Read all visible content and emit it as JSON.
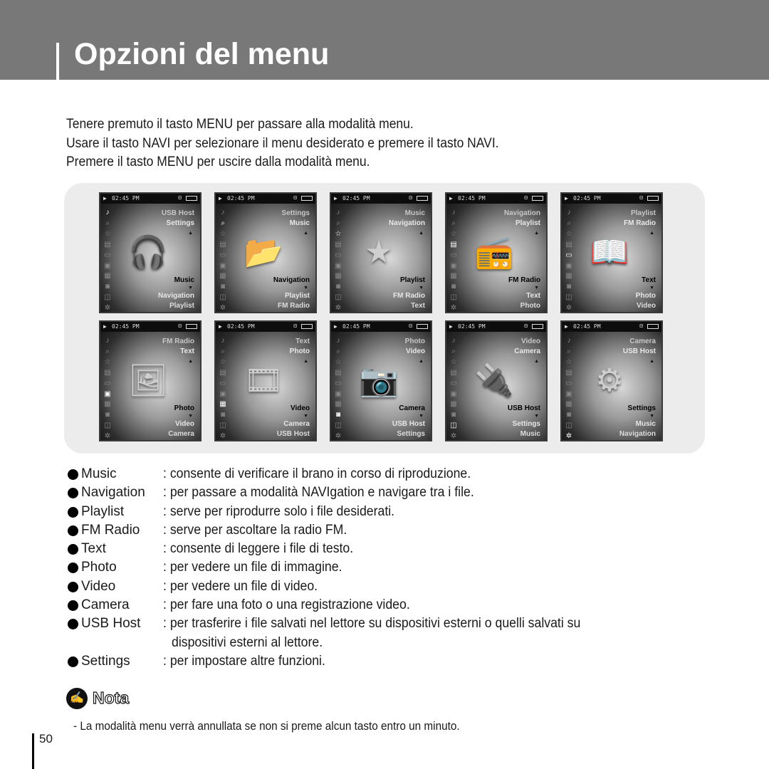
{
  "header": {
    "title": "Opzioni del menu",
    "color": "#787878"
  },
  "intro": [
    "Tenere premuto il tasto MENU per passare alla modalità menu.",
    "Usare il tasto NAVI per selezionare il menu desiderato e premere il tasto NAVI.",
    "Premere il tasto MENU per uscire dalla modalità menu."
  ],
  "screens": [
    {
      "time": "02:45 PM",
      "prev1": "USB Host",
      "prev2": "Settings",
      "current": "Music",
      "next1": "Navigation",
      "next2": "Playlist",
      "art": "headphones-icon",
      "glyph": "🎧",
      "active": 0
    },
    {
      "time": "02:45 PM",
      "prev1": "Settings",
      "prev2": "Music",
      "current": "Navigation",
      "next1": "Playlist",
      "next2": "FM Radio",
      "art": "folder-magnifier-icon",
      "glyph": "📂",
      "active": 1
    },
    {
      "time": "02:45 PM",
      "prev1": "Music",
      "prev2": "Navigation",
      "current": "Playlist",
      "next1": "FM Radio",
      "next2": "Text",
      "art": "star-icon",
      "glyph": "★",
      "active": 2
    },
    {
      "time": "02:45 PM",
      "prev1": "Navigation",
      "prev2": "Playlist",
      "current": "FM Radio",
      "next1": "Text",
      "next2": "Photo",
      "art": "radio-icon",
      "glyph": "📻",
      "active": 3
    },
    {
      "time": "02:45 PM",
      "prev1": "Playlist",
      "prev2": "FM Radio",
      "current": "Text",
      "next1": "Photo",
      "next2": "Video",
      "art": "book-icon",
      "glyph": "📖",
      "active": 4
    },
    {
      "time": "02:45 PM",
      "prev1": "FM Radio",
      "prev2": "Text",
      "current": "Photo",
      "next1": "Video",
      "next2": "Camera",
      "art": "photo-album-icon",
      "glyph": "🖼",
      "active": 5
    },
    {
      "time": "02:45 PM",
      "prev1": "Text",
      "prev2": "Photo",
      "current": "Video",
      "next1": "Camera",
      "next2": "USB Host",
      "art": "film-reel-icon",
      "glyph": "🎞",
      "active": 6
    },
    {
      "time": "02:45 PM",
      "prev1": "Photo",
      "prev2": "Video",
      "current": "Camera",
      "next1": "USB Host",
      "next2": "Settings",
      "art": "camera-icon",
      "glyph": "📷",
      "active": 7
    },
    {
      "time": "02:45 PM",
      "prev1": "Video",
      "prev2": "Camera",
      "current": "USB Host",
      "next1": "Settings",
      "next2": "Music",
      "art": "usb-stick-icon",
      "glyph": "🔌",
      "active": 8
    },
    {
      "time": "02:45 PM",
      "prev1": "Camera",
      "prev2": "USB Host",
      "current": "Settings",
      "next1": "Music",
      "next2": "Navigation",
      "art": "gear-icon",
      "glyph": "⚙",
      "active": 9
    }
  ],
  "side_icons": [
    "♪",
    "⌕",
    "☆",
    "▤",
    "▭",
    "▣",
    "▦",
    "◙",
    "◫",
    "✲"
  ],
  "menu_items": [
    {
      "term": "Music",
      "desc": ": consente di verificare il brano in corso di riproduzione."
    },
    {
      "term": "Navigation",
      "desc": ": per passare a modalità NAVIgation e navigare tra i file."
    },
    {
      "term": "Playlist",
      "desc": ": serve per riprodurre solo i file desiderati."
    },
    {
      "term": "FM Radio",
      "desc": ": serve per ascoltare la radio FM."
    },
    {
      "term": "Text",
      "desc": ": consente di leggere i file di testo."
    },
    {
      "term": "Photo",
      "desc": ": per vedere un file di immagine."
    },
    {
      "term": "Video",
      "desc": ": per vedere un file di video."
    },
    {
      "term": "Camera",
      "desc": ": per fare una foto o una registrazione video."
    },
    {
      "term": "USB Host",
      "desc": ": per trasferire i file salvati nel lettore su dispositivi esterni o quelli salvati su",
      "desc2": "dispositivi esterni al lettore."
    },
    {
      "term": "Settings",
      "desc": ": per impostare altre funzioni."
    }
  ],
  "note": {
    "icon": "pencil-note-icon",
    "title": "Nota",
    "text": "- La modalità menu verrà annullata se non si preme alcun tasto entro un minuto."
  },
  "page_number": "50"
}
